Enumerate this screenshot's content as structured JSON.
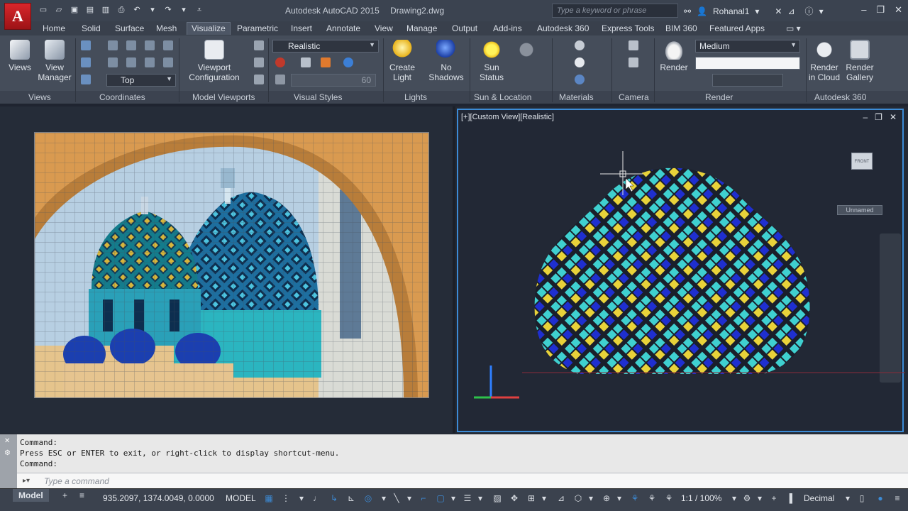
{
  "window": {
    "app_name": "Autodesk AutoCAD 2015",
    "file_name": "Drawing2.dwg",
    "search_placeholder": "Type a keyword or phrase",
    "user": "Rohanal1",
    "app_letter": "A"
  },
  "tabs": [
    {
      "label": "Home"
    },
    {
      "label": "Solid"
    },
    {
      "label": "Surface"
    },
    {
      "label": "Mesh"
    },
    {
      "label": "Visualize",
      "active": true
    },
    {
      "label": "Parametric"
    },
    {
      "label": "Insert"
    },
    {
      "label": "Annotate"
    },
    {
      "label": "View"
    },
    {
      "label": "Manage"
    },
    {
      "label": "Output"
    },
    {
      "label": "Add-ins"
    },
    {
      "label": "Autodesk 360"
    },
    {
      "label": "Express Tools"
    },
    {
      "label": "BIM 360"
    },
    {
      "label": "Featured Apps"
    }
  ],
  "ribbon": {
    "views_label": "Views",
    "view_manager_label": "View Manager",
    "view_combo": "Top",
    "viewport_config_label": "Viewport Configuration",
    "visual_style_combo": "Realistic",
    "opacity_value": "60",
    "create_light_label": "Create Light",
    "no_shadows_label": "No Shadows",
    "sun_status_label": "Sun Status",
    "render_label": "Render",
    "render_preset_combo": "Medium",
    "render_in_cloud_label": "Render in Cloud",
    "render_gallery_label": "Render Gallery",
    "panels": {
      "views": "Views",
      "coordinates": "Coordinates",
      "model_viewports": "Model Viewports",
      "visual_styles": "Visual Styles",
      "lights": "Lights",
      "sun_location": "Sun & Location",
      "materials": "Materials",
      "camera": "Camera",
      "render": "Render",
      "autodesk360": "Autodesk 360"
    }
  },
  "viewport": {
    "label": "[+][Custom View][Realistic]",
    "unnamed": "Unnamed",
    "viewcube_face": "FRONT"
  },
  "command": {
    "history": [
      "Command:",
      "Press ESC or ENTER to exit, or right-click to display shortcut-menu.",
      "Command:"
    ],
    "placeholder": "Type a command"
  },
  "status": {
    "tab_model": "Model",
    "coords": "935.2097, 1374.0049, 0.0000",
    "space": "MODEL",
    "scale": "1:1 / 100%",
    "units": "Decimal"
  },
  "colors": {
    "accent": "#3c8bd6",
    "dome_dark": "#1a1f2b",
    "dome_cyan": "#3fd0d0",
    "dome_blue": "#1f2fd0",
    "dome_yellow": "#e8d23a"
  }
}
